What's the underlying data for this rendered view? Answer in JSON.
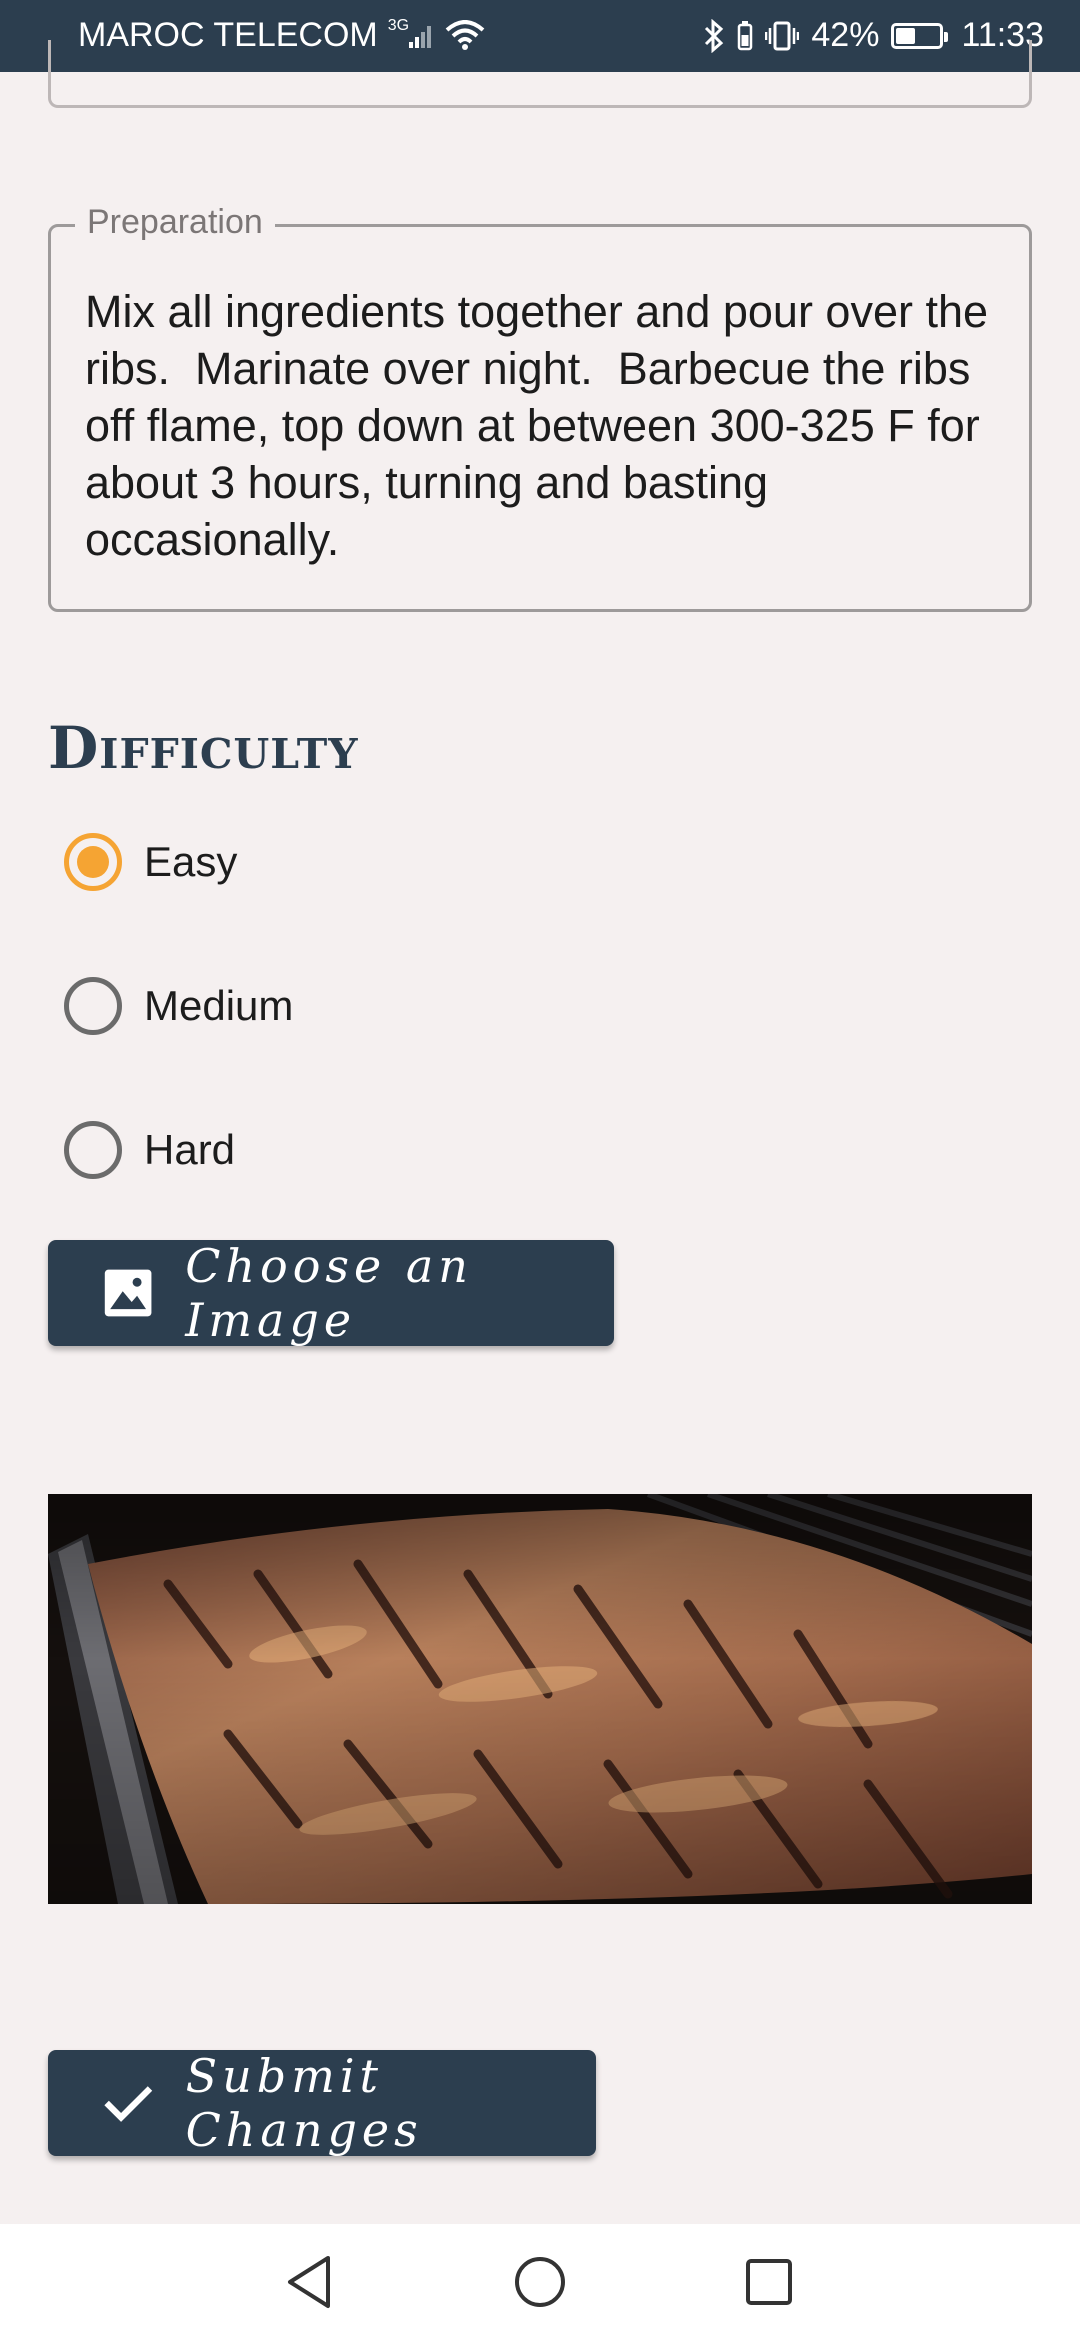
{
  "status_bar": {
    "carrier": "MAROC TELECOM",
    "network": "3G",
    "battery": "42%",
    "time": "11:33",
    "icons": [
      "signal-icon",
      "wifi-icon",
      "bluetooth-icon",
      "vibrate-icon",
      "battery-icon"
    ]
  },
  "preparation": {
    "label": "Preparation",
    "text": "Mix all ingredients together and pour over the ribs.  Marinate over night.  Barbecue the ribs off flame, top down at between 300-325 F for about 3 hours, turning and basting occasionally."
  },
  "difficulty": {
    "heading": "Difficulty",
    "options": [
      "Easy",
      "Medium",
      "Hard"
    ],
    "selected": "Easy",
    "accent_color": "#f5a433"
  },
  "image_button": {
    "label": "Choose an Image",
    "icon": "image-icon"
  },
  "submit_button": {
    "label": "Submit Changes",
    "icon": "checkmark-icon"
  },
  "nav_bar": {
    "icons": [
      "back-icon",
      "home-icon",
      "recents-icon"
    ]
  },
  "colors": {
    "primary": "#2c3e4f",
    "background": "#f5f0f0"
  }
}
